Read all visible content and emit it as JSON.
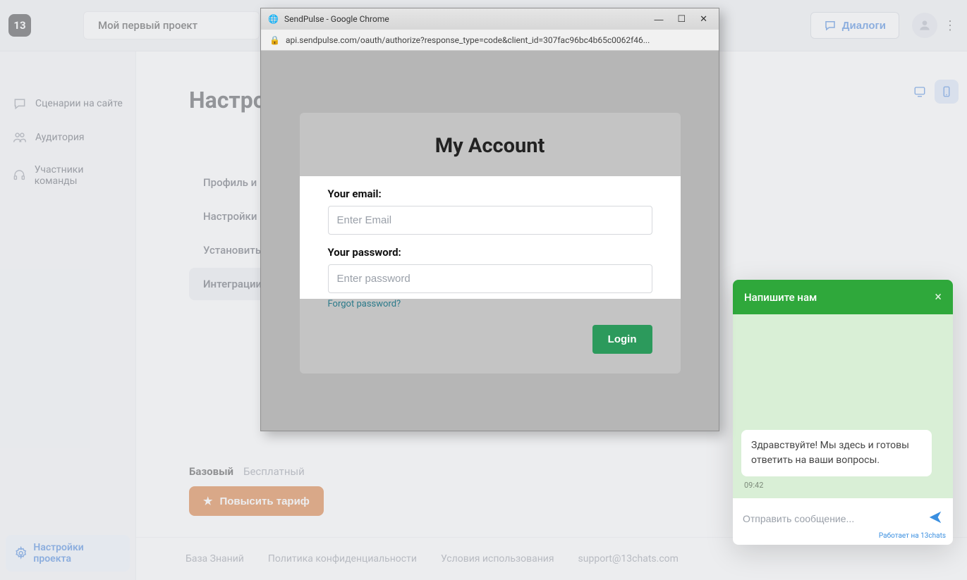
{
  "topbar": {
    "logo_text": "13",
    "project_name": "Мой первый проект",
    "dialogs_label": "Диалоги"
  },
  "sidebar": {
    "items": [
      {
        "label": "Сценарии на сайте"
      },
      {
        "label": "Аудитория"
      },
      {
        "label": "Участники команды"
      }
    ],
    "settings_label": "Настройки проекта"
  },
  "page": {
    "title": "Настро",
    "tabs": [
      {
        "label": "Профиль и вне"
      },
      {
        "label": "Настройки вид"
      },
      {
        "label": "Установить ко"
      },
      {
        "label": "Интеграции"
      }
    ]
  },
  "plan": {
    "name": "Базовый",
    "free": "Бесплатный",
    "upgrade_label": "Повысить тариф"
  },
  "footer": {
    "kb": "База Знаний",
    "privacy": "Политика конфиденциальности",
    "terms": "Условия использования",
    "support": "support@13chats.com"
  },
  "chat": {
    "title": "Напишите нам",
    "greeting": "Здравствуйте! Мы здесь и готовы ответить на ваши вопросы.",
    "time": "09:42",
    "placeholder": "Отправить сообщение...",
    "powered": "Работает на 13chats"
  },
  "popup": {
    "window_title": "SendPulse - Google Chrome",
    "url": "api.sendpulse.com/oauth/authorize?response_type=code&client_id=307fac96bc4b65c0062f46...",
    "card_title": "My Account",
    "email_label": "Your email:",
    "email_placeholder": "Enter Email",
    "password_label": "Your password:",
    "password_placeholder": "Enter password",
    "forgot": "Forgot password?",
    "login": "Login"
  }
}
